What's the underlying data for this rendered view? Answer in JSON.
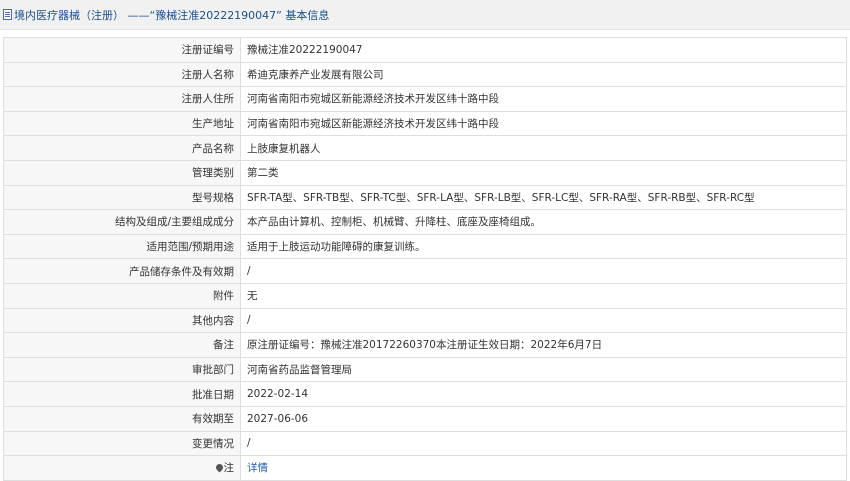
{
  "header": {
    "title": "境内医疗器械（注册） ——“豫械注准20222190047” 基本信息"
  },
  "rows": [
    {
      "label": "注册证编号",
      "value": "豫械注准20222190047"
    },
    {
      "label": "注册人名称",
      "value": "希迪克康养产业发展有限公司"
    },
    {
      "label": "注册人住所",
      "value": "河南省南阳市宛城区新能源经济技术开发区纬十路中段"
    },
    {
      "label": "生产地址",
      "value": "河南省南阳市宛城区新能源经济技术开发区纬十路中段"
    },
    {
      "label": "产品名称",
      "value": "上肢康复机器人"
    },
    {
      "label": "管理类别",
      "value": "第二类"
    },
    {
      "label": "型号规格",
      "value": "SFR-TA型、SFR-TB型、SFR-TC型、SFR-LA型、SFR-LB型、SFR-LC型、SFR-RA型、SFR-RB型、SFR-RC型"
    },
    {
      "label": "结构及组成/主要组成成分",
      "value": "本产品由计算机、控制柜、机械臂、升降柱、底座及座椅组成。"
    },
    {
      "label": "适用范围/预期用途",
      "value": "适用于上肢运动功能障碍的康复训练。"
    },
    {
      "label": "产品储存条件及有效期",
      "value": "/"
    },
    {
      "label": "附件",
      "value": "无"
    },
    {
      "label": "其他内容",
      "value": "/"
    },
    {
      "label": "备注",
      "value": "原注册证编号：豫械注准20172260370本注册证生效日期：2022年6月7日"
    },
    {
      "label": "审批部门",
      "value": "河南省药品监督管理局"
    },
    {
      "label": "批准日期",
      "value": "2022-02-14"
    },
    {
      "label": "有效期至",
      "value": "2027-06-06"
    },
    {
      "label": "变更情况",
      "value": "/"
    }
  ],
  "note_row": {
    "label": "注",
    "link_text": "详情",
    "icon": "pin-icon"
  },
  "colors": {
    "title_text": "#1a4f8b",
    "label_bg": "#f7f7f7",
    "border": "#dedede",
    "link": "#1a5fb4"
  }
}
